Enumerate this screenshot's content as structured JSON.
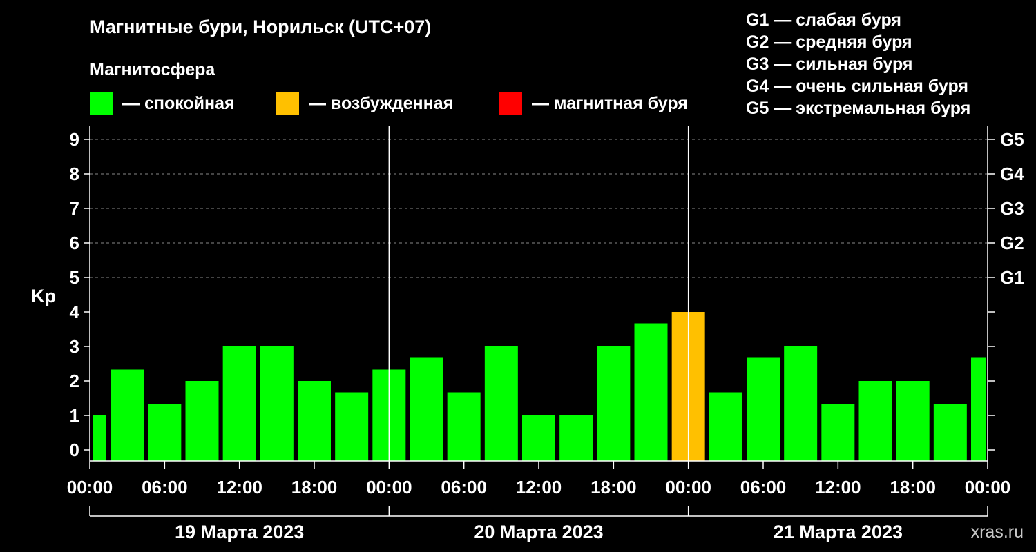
{
  "chart_data": {
    "type": "bar",
    "title": "Магнитные бури, Норильск (UTC+07)",
    "subtitle": "Магнитосфера",
    "ylabel": "Kp",
    "ylim": [
      0,
      9
    ],
    "yticks": [
      "0",
      "1",
      "2",
      "3",
      "4",
      "5",
      "6",
      "7",
      "8",
      "9"
    ],
    "right_ticks": [
      {
        "level": 5,
        "label": "G1"
      },
      {
        "level": 6,
        "label": "G2"
      },
      {
        "level": 7,
        "label": "G3"
      },
      {
        "level": 8,
        "label": "G4"
      },
      {
        "level": 9,
        "label": "G5"
      }
    ],
    "legend": [
      {
        "label": "— спокойная",
        "color": "#00ff00"
      },
      {
        "label": "— возбужденная",
        "color": "#ffc000"
      },
      {
        "label": "— магнитная буря",
        "color": "#ff0000"
      }
    ],
    "storm_scale": [
      "G1 — слабая буря",
      "G2 — средняя буря",
      "G3 — сильная буря",
      "G4 — очень сильная буря",
      "G5 — экстремальная буря"
    ],
    "x_tick_labels": [
      "00:00",
      "06:00",
      "12:00",
      "18:00",
      "00:00",
      "06:00",
      "12:00",
      "18:00",
      "00:00",
      "06:00",
      "12:00",
      "18:00",
      "00:00"
    ],
    "days": [
      "19 Марта 2023",
      "20 Марта 2023",
      "21 Марта 2023"
    ],
    "grid": "dashed horizontal at Kp 5–9",
    "values": [
      1.0,
      2.33,
      1.33,
      2.0,
      3.0,
      3.0,
      2.0,
      1.67,
      2.33,
      2.67,
      1.67,
      3.0,
      1.0,
      1.0,
      3.0,
      3.67,
      4.0,
      1.67,
      2.67,
      3.0,
      1.33,
      2.0,
      2.0,
      1.33,
      2.67
    ],
    "bar_colors": [
      "#00ff00",
      "#00ff00",
      "#00ff00",
      "#00ff00",
      "#00ff00",
      "#00ff00",
      "#00ff00",
      "#00ff00",
      "#00ff00",
      "#00ff00",
      "#00ff00",
      "#00ff00",
      "#00ff00",
      "#00ff00",
      "#00ff00",
      "#00ff00",
      "#ffc000",
      "#00ff00",
      "#00ff00",
      "#00ff00",
      "#00ff00",
      "#00ff00",
      "#00ff00",
      "#00ff00",
      "#00ff00"
    ]
  },
  "watermark": "xras.ru"
}
